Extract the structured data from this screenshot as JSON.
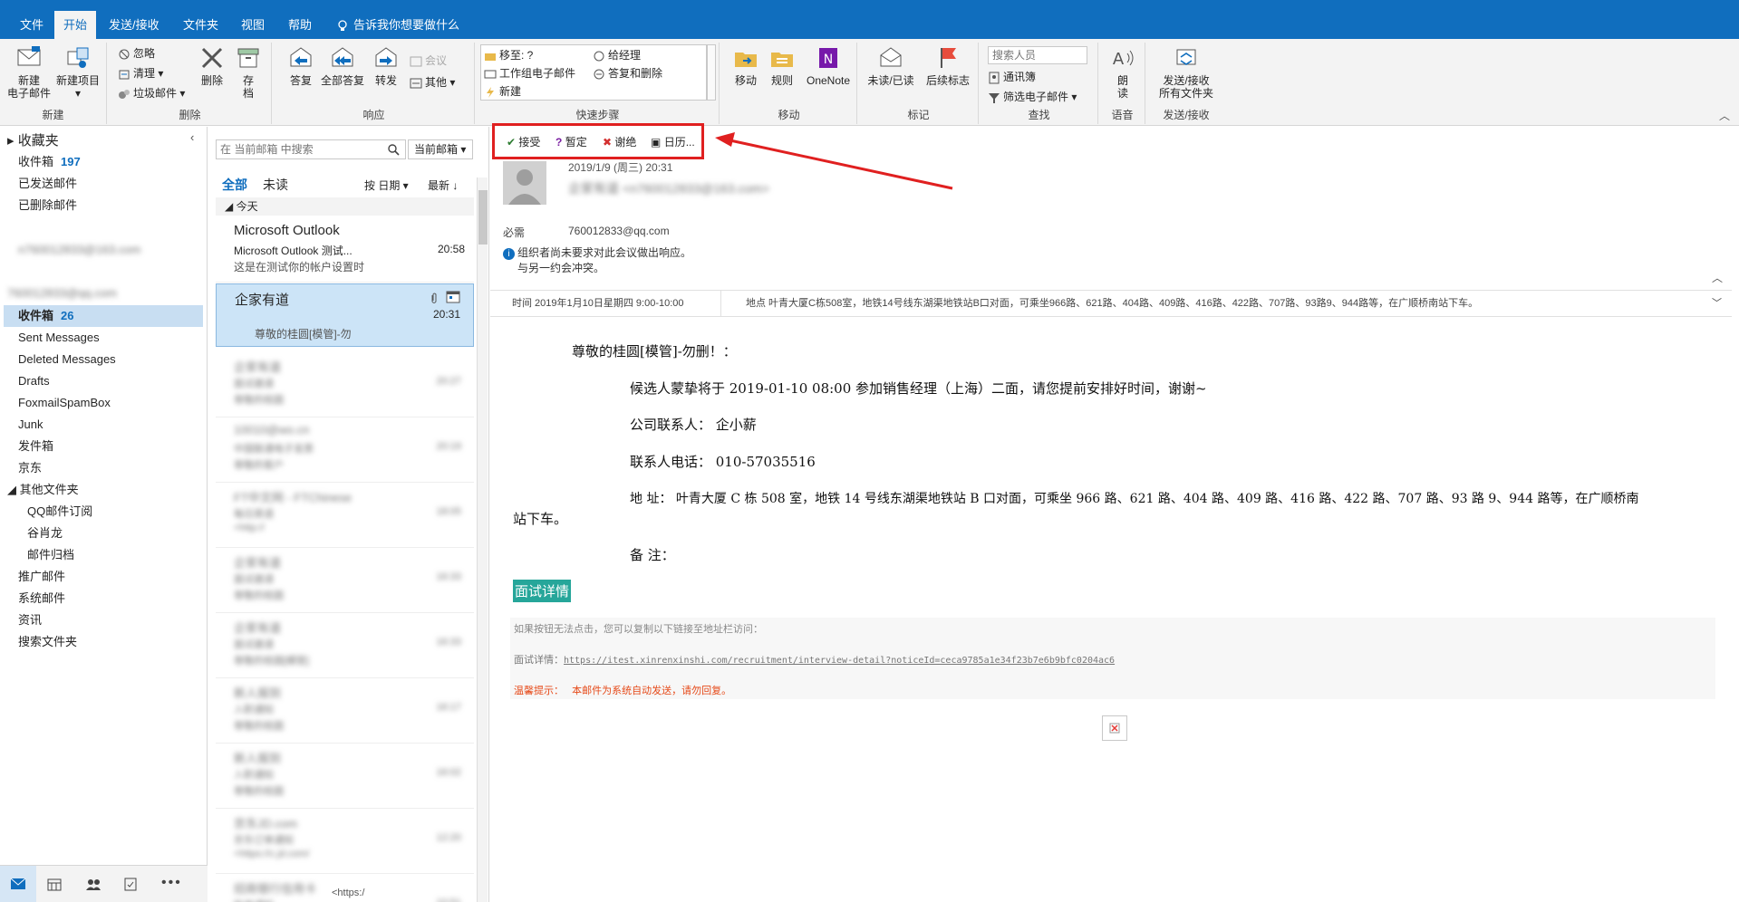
{
  "ribbon_tabs": {
    "file": "文件",
    "home": "开始",
    "sendrecv": "发送/接收",
    "folder": "文件夹",
    "view": "视图",
    "help": "帮助",
    "tellme": "告诉我你想要做什么"
  },
  "groups": {
    "new": {
      "label": "新建",
      "new_email_1": "新建",
      "new_email_2": "电子邮件",
      "new_items_1": "新建项目",
      "new_items_2": "▾"
    },
    "delete": {
      "label": "删除",
      "ignore": "忽略",
      "cleanup": "清理 ▾",
      "junk": "垃圾邮件 ▾",
      "delete": "删除",
      "archive_1": "存",
      "archive_2": "档"
    },
    "respond": {
      "label": "响应",
      "reply": "答复",
      "reply_all": "全部答复",
      "forward": "转发",
      "meeting": "会议",
      "more": "其他 ▾"
    },
    "quicksteps": {
      "label": "快速步骤",
      "moveto": "移至: ?",
      "manager": "给经理",
      "team": "工作组电子邮件",
      "replydelete": "答复和删除",
      "new": "新建"
    },
    "move": {
      "label": "移动",
      "move": "移动",
      "rules": "规则",
      "onenote": "OneNote"
    },
    "tags": {
      "label": "标记",
      "unread": "未读/已读",
      "followup": "后续标志"
    },
    "find": {
      "label": "查找",
      "search_people_placeholder": "搜索人员",
      "addressbook": "通讯簿",
      "filter": "筛选电子邮件 ▾"
    },
    "speech": {
      "label": "语音",
      "read_1": "朗",
      "read_2": "读"
    },
    "sendrecv": {
      "label": "发送/接收",
      "btn_1": "发送/接收",
      "btn_2": "所有文件夹"
    }
  },
  "nav": {
    "favorites": "收藏夹",
    "inbox": "收件箱",
    "inbox_count": "197",
    "sent": "已发送邮件",
    "deleted": "已删除邮件",
    "account1": "n760012833@163.com",
    "account2": "760012833@qq.com",
    "inbox2": "收件箱",
    "inbox2_count": "26",
    "folders": [
      "Sent Messages",
      "Deleted Messages",
      "Drafts",
      "FoxmailSpamBox",
      "Junk",
      "发件箱",
      "京东"
    ],
    "other": "其他文件夹",
    "sub": [
      "QQ邮件订阅",
      "谷肖龙",
      "邮件归档"
    ],
    "more": [
      "推广邮件",
      "系统邮件",
      "资讯",
      "搜索文件夹"
    ]
  },
  "search": {
    "placeholder": "在 当前邮箱 中搜索",
    "scope": "当前邮箱"
  },
  "list": {
    "all": "全部",
    "unread": "未读",
    "sort": "按 日期 ▾",
    "order": "最新 ↓",
    "today": "今天",
    "item1": {
      "sender": "Microsoft Outlook",
      "subject": "Microsoft Outlook 测试...",
      "time": "20:58",
      "preview": "这是在测试你的帐户设置时"
    },
    "item2": {
      "sender": "企家有道",
      "time": "20:31",
      "preview": "尊敬的桂圆[模管]-勿"
    },
    "blurred": [
      {
        "sender": "企家有道",
        "subject": "面试邀请",
        "time": "20:27",
        "preview": "尊敬的桂圆"
      },
      {
        "sender": "10010@wo.cn",
        "subject": "中国联通电子发票",
        "time": "20:19",
        "preview": "尊敬的客户"
      },
      {
        "sender": "FT中文网 - FTChinese",
        "subject": "每日英语",
        "time": "18:05",
        "preview": "<http://"
      },
      {
        "sender": "企家有道",
        "subject": "面试邀请",
        "time": "16:33",
        "preview": "尊敬的桂圆"
      },
      {
        "sender": "企家有道",
        "subject": "面试邀请",
        "time": "16:33",
        "preview": "尊敬的桂圆[模管]"
      },
      {
        "sender": "新人报到",
        "subject": "入职通知",
        "time": "16:17",
        "preview": "尊敬的桂圆"
      },
      {
        "sender": "新人报到",
        "subject": "入职通知",
        "time": "16:02",
        "preview": "尊敬的桂圆"
      },
      {
        "sender": "京东JD.com",
        "subject": "京东订单通知",
        "time": "12:20",
        "preview": "<https://c.jd.com/"
      },
      {
        "sender": "招商银行信用卡",
        "subject": "账单通知",
        "time": "10:51",
        "preview": "尊敬的客户"
      }
    ],
    "footer": "<https:/"
  },
  "meeting": {
    "accept": "接受",
    "tentative": "暂定",
    "decline": "谢绝",
    "calendar": "日历...",
    "date": "2019/1/9 (周三) 20:31",
    "from": "企家有道 <n760012833@163.com>",
    "required_label": "必需",
    "required": "760012833@qq.com",
    "info1": "组织者尚未要求对此会议做出响应。",
    "info2": "与另一约会冲突。",
    "time": "时间 2019年1月10日星期四 9:00-10:00",
    "location": "地点 叶青大厦C栋508室，地铁14号线东湖渠地铁站B口对面，可乘坐966路、621路、404路、409路、416路、422路、707路、93路9、944路等，在广顺桥南站下车。"
  },
  "body": {
    "greeting": "尊敬的桂圆[模管]-勿删！：",
    "line1": "候选人蒙挚将于 2019-01-10 08:00 参加销售经理（上海）二面，请您提前安排好时间，谢谢~",
    "contact": "公司联系人：  企小薪",
    "phone": "联系人电话：  010-57035516",
    "address_1": "地  址：  叶青大厦 C 栋 508 室，地铁 14 号线东湖渠地铁站 B 口对面，可乘坐 966 路、621 路、404 路、409 路、416 路、422 路、707 路、93 路 9、944 路等，在广顺桥南",
    "address_2": "站下车。",
    "remark": "备  注：",
    "details_button": "面试详情",
    "hint": "如果按钮无法点击，您可以复制以下链接至地址栏访问：",
    "link_label": "面试详情：",
    "link": "https://itest.xinrenxinshi.com/recruitment/interview-detail?noticeId=ceca9785a1e34f23b7e6b9bfc0204ac6",
    "warn_label": "温馨提示：",
    "warn": "本邮件为系统自动发送，请勿回复。"
  },
  "colors": {
    "accent": "#106ebe",
    "highlight_box": "#e02020",
    "details_bg": "#26a69a"
  }
}
